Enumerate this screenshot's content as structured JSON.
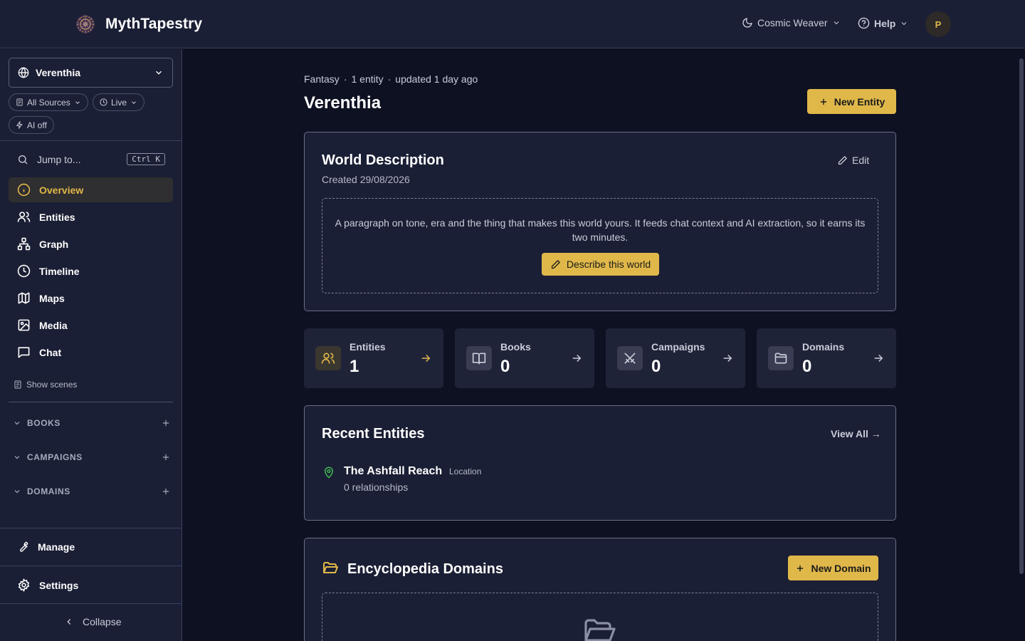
{
  "header": {
    "app_title": "MythTapestry",
    "theme_label": "Cosmic Weaver",
    "help_label": "Help",
    "avatar_initial": "P"
  },
  "sidebar": {
    "world_name": "Verenthia",
    "filters": {
      "sources": "All Sources",
      "live": "Live",
      "ai": "AI off"
    },
    "jump_label": "Jump to...",
    "jump_shortcut": "Ctrl K",
    "nav": [
      {
        "label": "Overview",
        "icon": "info-icon",
        "active": true
      },
      {
        "label": "Entities",
        "icon": "users-icon"
      },
      {
        "label": "Graph",
        "icon": "graph-icon"
      },
      {
        "label": "Timeline",
        "icon": "clock-icon"
      },
      {
        "label": "Maps",
        "icon": "map-icon"
      },
      {
        "label": "Media",
        "icon": "image-icon"
      },
      {
        "label": "Chat",
        "icon": "chat-icon"
      }
    ],
    "show_scenes": "Show scenes",
    "sections": [
      {
        "label": "BOOKS"
      },
      {
        "label": "CAMPAIGNS"
      },
      {
        "label": "DOMAINS"
      }
    ],
    "manage": "Manage",
    "settings": "Settings",
    "collapse": "Collapse"
  },
  "main": {
    "meta": {
      "genre": "Fantasy",
      "entity_count": "1 entity",
      "updated": "updated 1 day ago",
      "separator": "·"
    },
    "title": "Verenthia",
    "new_entity": "New Entity",
    "world_description": {
      "title": "World Description",
      "created": "Created 29/08/2026",
      "edit": "Edit",
      "placeholder": "A paragraph on tone, era and the thing that makes this world yours. It feeds chat context and AI extraction, so it earns its two minutes.",
      "describe_button": "Describe this world"
    },
    "stats": [
      {
        "label": "Entities",
        "value": "1",
        "icon": "users-icon",
        "accent": "#e0b84a"
      },
      {
        "label": "Books",
        "value": "0",
        "icon": "book-icon"
      },
      {
        "label": "Campaigns",
        "value": "0",
        "icon": "swords-icon"
      },
      {
        "label": "Domains",
        "value": "0",
        "icon": "folder-icon"
      }
    ],
    "recent_entities": {
      "title": "Recent Entities",
      "view_all": "View All →",
      "items": [
        {
          "name": "The Ashfall Reach",
          "type": "Location",
          "relationships": "0 relationships",
          "icon": "map-pin-icon"
        }
      ]
    },
    "domains": {
      "title": "Encyclopedia Domains",
      "new_domain": "New Domain"
    }
  },
  "colors": {
    "accent": "#e0b84a",
    "background": "#0e1122",
    "panel": "#1b1f35",
    "location_pin": "#3fb950"
  }
}
